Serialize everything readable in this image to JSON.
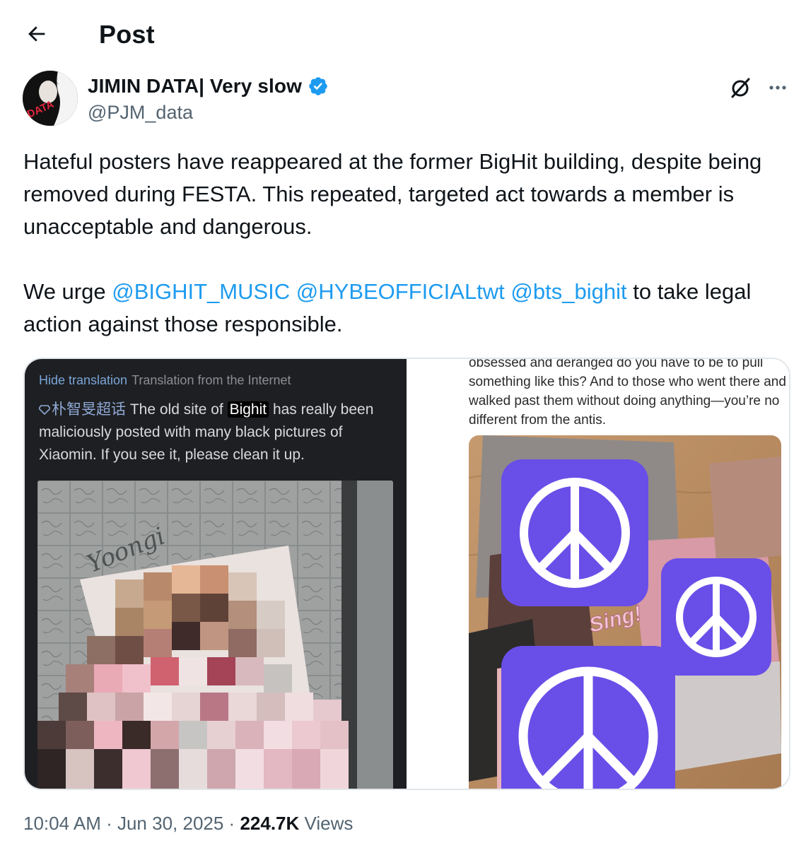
{
  "header": {
    "title": "Post",
    "back_icon": "arrow-left-icon"
  },
  "author": {
    "name": "JIMIN DATA| Very slow",
    "handle": "@PJM_data",
    "verified_icon": "verified-badge-icon",
    "avatar_text": "JIMIN DATA",
    "avatar_text_short": "DATA"
  },
  "actions": {
    "grok_icon": "grok-slash-icon",
    "more_icon": "more-dots-icon"
  },
  "tweet": {
    "line1": "Hateful posters have reappeared at the former BigHit building, despite being removed during FESTA. This repeated, targeted act towards a member is unacceptable and dangerous.",
    "p2_prefix": "We urge ",
    "mention1": "@BIGHIT_MUSIC",
    "mention2": "@HYBEOFFICIALtwt",
    "mention3": "@bts_bighit",
    "p2_suffix": " to take legal action against those responsible."
  },
  "media_left": {
    "hide_translation": "Hide translation",
    "translation_from": "Translation from the Internet",
    "topic_tag": "朴智旻超话",
    "text_a": " The old site of ",
    "highlight": "Bighit",
    "text_b": " has really been maliciously posted with many black pictures of Xiaomin. If you see it, please clean it up.",
    "photo_handwriting": "Yoongi"
  },
  "media_right": {
    "text": "obsessed and deranged do you have to be to pull something like this? And to those who went there and walked past them without doing anything—you’re no different from the antis.",
    "poster_word": "Sing!",
    "peace_icon": "peace-sign-icon"
  },
  "footer": {
    "time": "10:04 AM",
    "sep": " · ",
    "date": "Jun 30, 2025",
    "sep2": " · ",
    "views_count": "224.7K",
    "views_label": " Views"
  },
  "colors": {
    "link": "#1d9bf0",
    "secondary": "#536471",
    "peace_purple": "#6a4ee8"
  }
}
